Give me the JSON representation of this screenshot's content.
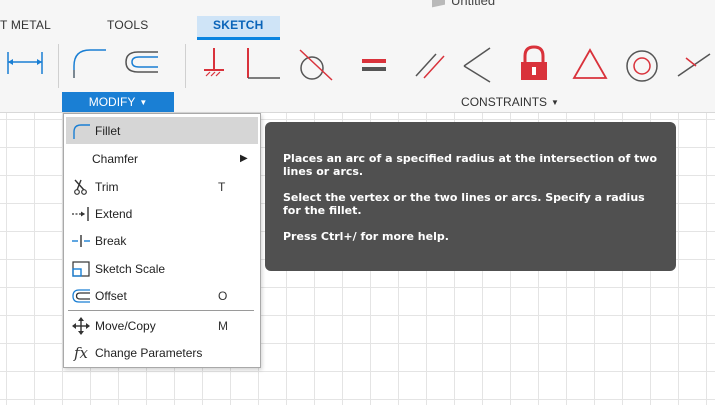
{
  "document": {
    "title": "Untitled"
  },
  "tabs": [
    {
      "label": "T METAL"
    },
    {
      "label": "TOOLS"
    },
    {
      "label": "SKETCH",
      "active": true
    }
  ],
  "toolbar": {
    "groups": [
      {
        "label": "MODIFY",
        "active": true
      },
      {
        "label": "CONSTRAINTS",
        "active": false
      }
    ]
  },
  "modify_menu": {
    "items": [
      {
        "label": "Fillet",
        "icon": "fillet-icon",
        "shortcut": "",
        "submenu": false,
        "highlighted": true
      },
      {
        "label": "Chamfer",
        "icon": "",
        "shortcut": "",
        "submenu": true
      },
      {
        "label": "Trim",
        "icon": "trim-icon",
        "shortcut": "T",
        "submenu": false
      },
      {
        "label": "Extend",
        "icon": "extend-icon",
        "shortcut": "",
        "submenu": false
      },
      {
        "label": "Break",
        "icon": "break-icon",
        "shortcut": "",
        "submenu": false
      },
      {
        "label": "Sketch Scale",
        "icon": "sketch-scale-icon",
        "shortcut": "",
        "submenu": false
      },
      {
        "label": "Offset",
        "icon": "offset-icon",
        "shortcut": "O",
        "submenu": false
      },
      {
        "label": "Move/Copy",
        "icon": "move-copy-icon",
        "shortcut": "M",
        "submenu": false
      },
      {
        "label": "Change Parameters",
        "icon": "change-parameters-icon",
        "shortcut": "",
        "submenu": false
      }
    ]
  },
  "tooltip": {
    "line1": "Places an arc of a specified radius at the intersection of two lines or arcs.",
    "line2": "Select the vertex or the two lines or arcs. Specify a radius for the fillet.",
    "line3": "Press Ctrl+/ for more help."
  },
  "colors": {
    "accent": "#1a7fd4",
    "constraint_red": "#d9323b",
    "tooltip_bg": "#505050"
  }
}
